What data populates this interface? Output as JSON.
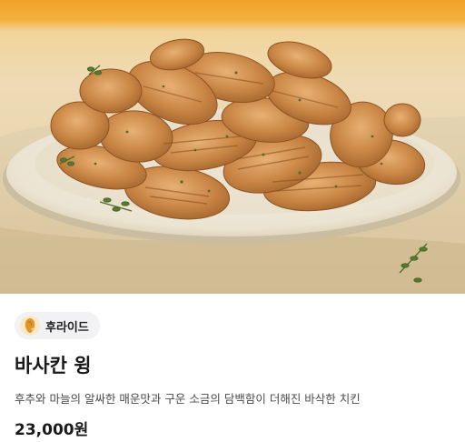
{
  "product": {
    "image_alt": "바사칸 윙",
    "category_chip": {
      "icon": "crispy-chicken-icon",
      "label": "후라이드"
    },
    "name": "바사칸 윙",
    "description": "후추와 마늘의 알싸한 매운맛과 구운 소금의 담백함이 더해진 바삭한 치킨",
    "price": "23,000원"
  },
  "colors": {
    "background": "#ffffff",
    "chip_background": "#f2f2f4",
    "hero_top_accent": "#f0a22a",
    "text_primary": "#1a1a1a",
    "text_secondary": "#4a4a4a"
  }
}
